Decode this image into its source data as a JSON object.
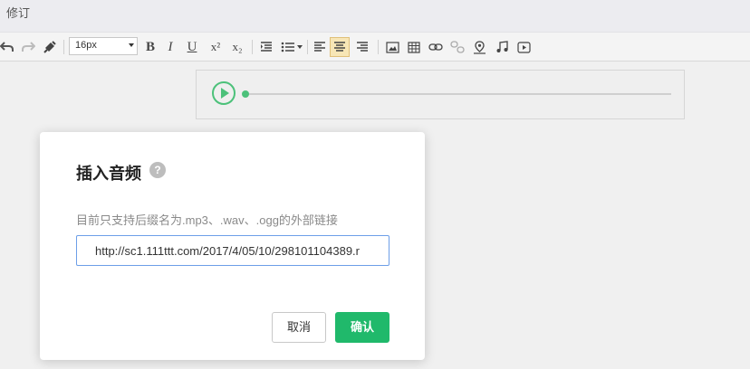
{
  "window": {
    "title": "修订"
  },
  "toolbar": {
    "font_size": "16px",
    "bold": "B",
    "italic": "I",
    "underline": "U",
    "superscript": "x²",
    "subscript": "x₂",
    "icons": [
      "undo-icon",
      "redo-icon",
      "format-painter-icon",
      "bold-icon",
      "italic-icon",
      "underline-icon",
      "superscript-icon",
      "subscript-icon",
      "indent-icon",
      "list-icon",
      "align-left-icon",
      "align-center-icon",
      "align-right-icon",
      "image-icon",
      "table-icon",
      "link-icon",
      "unlink-icon",
      "map-icon",
      "music-icon",
      "video-icon"
    ],
    "active_item": "align-center-icon",
    "active_color": "#f7e6b6"
  },
  "audio_player": {
    "progress": 0,
    "accent_color": "#4cc17a"
  },
  "dialog": {
    "title": "插入音频",
    "help_symbol": "?",
    "hint": "目前只支持后缀名为.mp3、.wav、.ogg的外部链接",
    "url_value": "http://sc1.111ttt.com/2017/4/05/10/298101104389.r",
    "cancel_label": "取消",
    "ok_label": "确认",
    "ok_color": "#20b96b"
  }
}
